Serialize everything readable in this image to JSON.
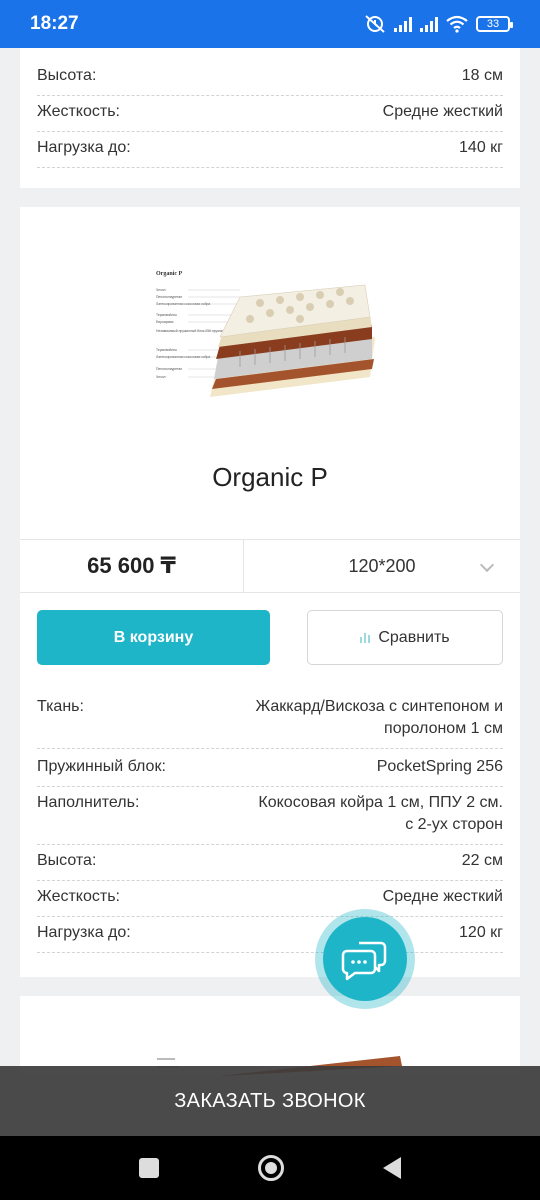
{
  "status_bar": {
    "time": "18:27",
    "battery": "33"
  },
  "card_top": {
    "specs": [
      {
        "key": "Высота:",
        "value": "18 см"
      },
      {
        "key": "Жесткость:",
        "value": "Средне жесткий"
      },
      {
        "key": "Нагрузка до:",
        "value": "140 кг"
      }
    ]
  },
  "product": {
    "image_label": "Organic P",
    "image_layers": [
      "Чехол",
      "Пенополиуретан",
      "Латексированная кокосовая койра",
      "Термовойлок",
      "Евроармас",
      "Независимый пружинный блок 256 пружин/м²",
      "Термовойлок",
      "Латексированная кокосовая койра",
      "Пенополиуретан",
      "Чехол"
    ],
    "title": "Organic P",
    "price": "65 600 ₸",
    "size": "120*200",
    "cart_label": "В корзину",
    "compare_label": "Сравнить",
    "specs": [
      {
        "key": "Ткань:",
        "value": "Жаккард/Вискоза с синтепоном и поролоном 1 см"
      },
      {
        "key": "Пружинный блок:",
        "value": "PocketSpring 256"
      },
      {
        "key": "Наполнитель:",
        "value": "Кокосовая койра 1 см, ППУ 2 см. с 2-ух сторон"
      },
      {
        "key": "Высота:",
        "value": "22 см"
      },
      {
        "key": "Жесткость:",
        "value": "Средне жесткий"
      },
      {
        "key": "Нагрузка до:",
        "value": "120 кг"
      }
    ]
  },
  "callback_label": "ЗАКАЗАТЬ ЗВОНОК",
  "colors": {
    "status_bar": "#1a73e8",
    "accent": "#1fb5c8",
    "page_bg": "#eef0f2"
  }
}
